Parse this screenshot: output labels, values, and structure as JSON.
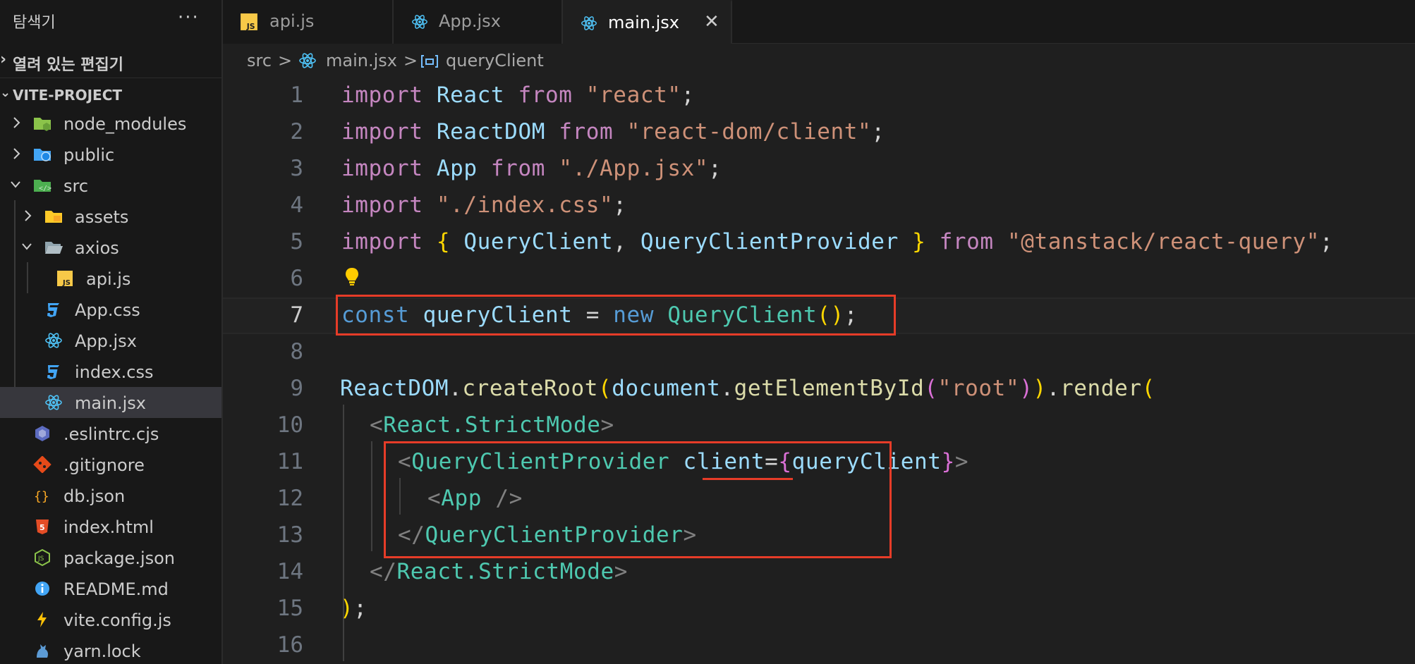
{
  "sidebar": {
    "title": "탐색기",
    "more": "···",
    "open_editors": "열려 있는 편집기",
    "project": "VITE-PROJECT",
    "items": [
      {
        "name": "node_modules"
      },
      {
        "name": "public"
      },
      {
        "name": "src"
      },
      {
        "name": "assets"
      },
      {
        "name": "axios"
      },
      {
        "name": "api.js"
      },
      {
        "name": "App.css"
      },
      {
        "name": "App.jsx"
      },
      {
        "name": "index.css"
      },
      {
        "name": "main.jsx"
      },
      {
        "name": ".eslintrc.cjs"
      },
      {
        "name": ".gitignore"
      },
      {
        "name": "db.json"
      },
      {
        "name": "index.html"
      },
      {
        "name": "package.json"
      },
      {
        "name": "README.md"
      },
      {
        "name": "vite.config.js"
      },
      {
        "name": "yarn.lock"
      }
    ]
  },
  "tabs": [
    {
      "label": "api.js",
      "icon": "js-icon"
    },
    {
      "label": "App.jsx",
      "icon": "react-icon"
    },
    {
      "label": "main.jsx",
      "icon": "react-icon",
      "active": true,
      "close": "✕"
    }
  ],
  "breadcrumb": {
    "parts": [
      "src",
      "main.jsx",
      "queryClient"
    ],
    "separator": ">"
  },
  "editor": {
    "line_numbers": [
      "1",
      "2",
      "3",
      "4",
      "5",
      "6",
      "7",
      "8",
      "9",
      "10",
      "11",
      "12",
      "13",
      "14",
      "15",
      "16"
    ],
    "current_line": "7"
  },
  "colors": {
    "highlight_box": "#e63c28",
    "background": "#1f1f1f"
  }
}
